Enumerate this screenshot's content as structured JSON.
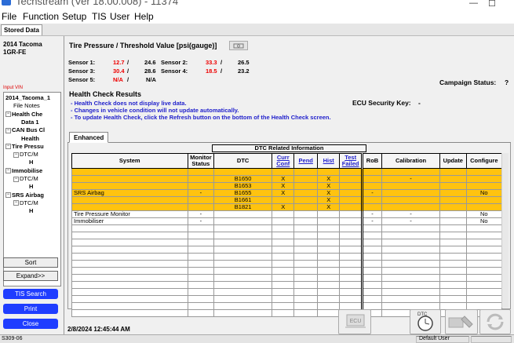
{
  "window": {
    "title": "Techstream (Ver 18.00.008) - 11374"
  },
  "menu": {
    "items": [
      "File",
      "Function",
      "Setup",
      "TIS",
      "User",
      "Help"
    ]
  },
  "toolbar": {
    "stored_data_tab": "Stored Data"
  },
  "vehicle": {
    "model": "2014 Tacoma",
    "engine": "1GR-FE"
  },
  "left": {
    "input_vin_label": "Input VIN",
    "tree": [
      {
        "exp": "",
        "text": "2014_Tacoma_1",
        "bold": true
      },
      {
        "exp": "",
        "text": "File Notes",
        "bold": false
      },
      {
        "exp": "−",
        "text": "Health Che",
        "bold": true
      },
      {
        "exp": "",
        "text": "Data 1",
        "bold": true
      },
      {
        "exp": "−",
        "text": "CAN Bus Cl",
        "bold": true
      },
      {
        "exp": "",
        "text": "Health",
        "bold": true
      },
      {
        "exp": "−",
        "text": "Tire Pressu",
        "bold": true
      },
      {
        "exp": "−",
        "text": "DTC/M",
        "bold": false
      },
      {
        "exp": "",
        "text": "H",
        "bold": true
      },
      {
        "exp": "−",
        "text": "Immobilise",
        "bold": true
      },
      {
        "exp": "−",
        "text": "DTC/M",
        "bold": false
      },
      {
        "exp": "",
        "text": "H",
        "bold": true
      },
      {
        "exp": "−",
        "text": "SRS Airbag",
        "bold": true
      },
      {
        "exp": "−",
        "text": "DTC/M",
        "bold": false
      },
      {
        "exp": "",
        "text": "H",
        "bold": true
      }
    ],
    "sort_label": "Sort",
    "expand_label": "Expand>>",
    "tis_search_label": "TIS Search",
    "print_label": "Print",
    "close_label": "Close"
  },
  "tire": {
    "title": "Tire Pressure / Threshold Value [psi(gauge)]",
    "sensor1_label": "Sensor 1:",
    "sensor1_value": "12.7",
    "sensor1_threshold": "24.6",
    "sensor2_label": "Sensor 2:",
    "sensor2_value": "33.3",
    "sensor2_threshold": "26.5",
    "sensor3_label": "Sensor 3:",
    "sensor3_value": "30.4",
    "sensor3_threshold": "28.6",
    "sensor4_label": "Sensor 4:",
    "sensor4_value": "18.5",
    "sensor4_threshold": "23.2",
    "sensor5_label": "Sensor 5:",
    "sensor5_value": "N/A",
    "sensor5_threshold": "N/A",
    "slash": "/"
  },
  "campaign": {
    "label": "Campaign Status:",
    "value": "?"
  },
  "ecu_security": {
    "label": "ECU Security Key:",
    "value": "-"
  },
  "health": {
    "title": "Health Check Results",
    "notes": [
      "- Health Check does not display live data.",
      "- Changes in vehicle condition will not update automatically.",
      "- To update Health Check, click the Refresh button on the bottom of the Health Check screen."
    ]
  },
  "tabs": {
    "enhanced": "Enhanced"
  },
  "table": {
    "group_header": "DTC Related Information",
    "headers": {
      "system": "System",
      "monitor_status": "Monitor Status",
      "dtc": "DTC",
      "curr_conf": "Curr Conf",
      "pend": "Pend",
      "hist": "Hist",
      "test_failed": "Test Failed",
      "rob": "RoB",
      "calibration": "Calibration",
      "update": "Update",
      "configure": "Configure"
    },
    "rows": [
      {
        "system": "",
        "monitor": "",
        "dtc": "",
        "curr": "",
        "pend": "",
        "hist": "",
        "test": "",
        "rob": "",
        "calibration": "",
        "update": "",
        "configure": "",
        "hl": true
      },
      {
        "system": "",
        "monitor": "",
        "dtc": "B1650",
        "curr": "X",
        "pend": "",
        "hist": "X",
        "test": "",
        "rob": "",
        "calibration": "-",
        "update": "",
        "configure": "",
        "hl": true
      },
      {
        "system": "",
        "monitor": "",
        "dtc": "B1653",
        "curr": "X",
        "pend": "",
        "hist": "X",
        "test": "",
        "rob": "",
        "calibration": "",
        "update": "",
        "configure": "",
        "hl": true
      },
      {
        "system": "SRS Airbag",
        "monitor": "-",
        "dtc": "B1655",
        "curr": "X",
        "pend": "",
        "hist": "X",
        "test": "",
        "rob": "-",
        "calibration": "",
        "update": "",
        "configure": "No",
        "hl": true
      },
      {
        "system": "",
        "monitor": "",
        "dtc": "B1661",
        "curr": "",
        "pend": "",
        "hist": "X",
        "test": "",
        "rob": "",
        "calibration": "",
        "update": "",
        "configure": "",
        "hl": true
      },
      {
        "system": "",
        "monitor": "",
        "dtc": "B1821",
        "curr": "X",
        "pend": "",
        "hist": "X",
        "test": "",
        "rob": "",
        "calibration": "",
        "update": "",
        "configure": "",
        "hl": true
      },
      {
        "system": "Tire Pressure Monitor",
        "monitor": "-",
        "dtc": "",
        "curr": "",
        "pend": "",
        "hist": "",
        "test": "",
        "rob": "-",
        "calibration": "-",
        "update": "",
        "configure": "No",
        "hl": false
      },
      {
        "system": "Immobiliser",
        "monitor": "-",
        "dtc": "",
        "curr": "",
        "pend": "",
        "hist": "",
        "test": "",
        "rob": "-",
        "calibration": "-",
        "update": "",
        "configure": "No",
        "hl": false
      }
    ],
    "empty_rows": 13
  },
  "footer": {
    "datetime": "2/8/2024 12:45:44 AM",
    "ecu_button_label": "ECU",
    "dtc_button_label": "DTC"
  },
  "statusbar": {
    "left": "S309-06",
    "user": "Default User"
  },
  "colors": {
    "highlight": "#ffc30f",
    "red_value": "#e00000",
    "link_blue": "#2222cc",
    "button_blue": "#1f3dff"
  }
}
